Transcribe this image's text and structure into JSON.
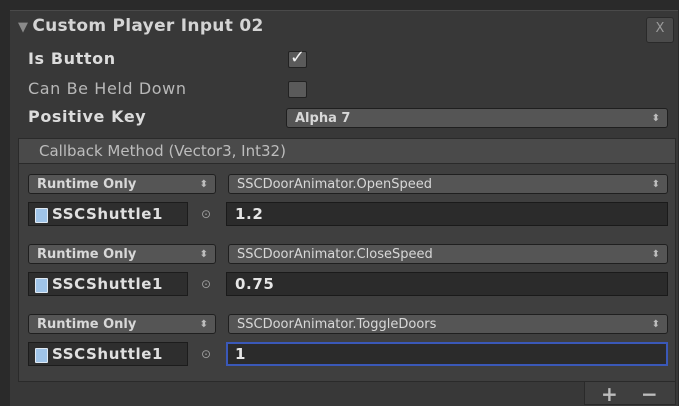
{
  "component": {
    "title": "Custom Player Input 02",
    "close_glyph": "X"
  },
  "properties": {
    "is_button_label": "Is Button",
    "is_button_checked": true,
    "can_be_held_label": "Can Be Held Down",
    "can_be_held_checked": false,
    "positive_key_label": "Positive Key",
    "positive_key_value": "Alpha 7"
  },
  "callback": {
    "header": "Callback Method (Vector3, Int32)",
    "entries": [
      {
        "mode": "Runtime Only",
        "method": "SSCDoorAnimator.OpenSpeed",
        "object": "SSCShuttle1",
        "value": "1.2"
      },
      {
        "mode": "Runtime Only",
        "method": "SSCDoorAnimator.CloseSpeed",
        "object": "SSCShuttle1",
        "value": "0.75"
      },
      {
        "mode": "Runtime Only",
        "method": "SSCDoorAnimator.ToggleDoors",
        "object": "SSCShuttle1",
        "value": "1"
      }
    ],
    "add_glyph": "+",
    "remove_glyph": "−"
  },
  "icons": {
    "foldout": "triangle-down",
    "dropdown": "up-down-arrows",
    "object": "script-icon",
    "target": "circle-target"
  },
  "colors": {
    "background": "#383838",
    "field": "#2b2b2b",
    "active_border": "#3a58b8"
  }
}
